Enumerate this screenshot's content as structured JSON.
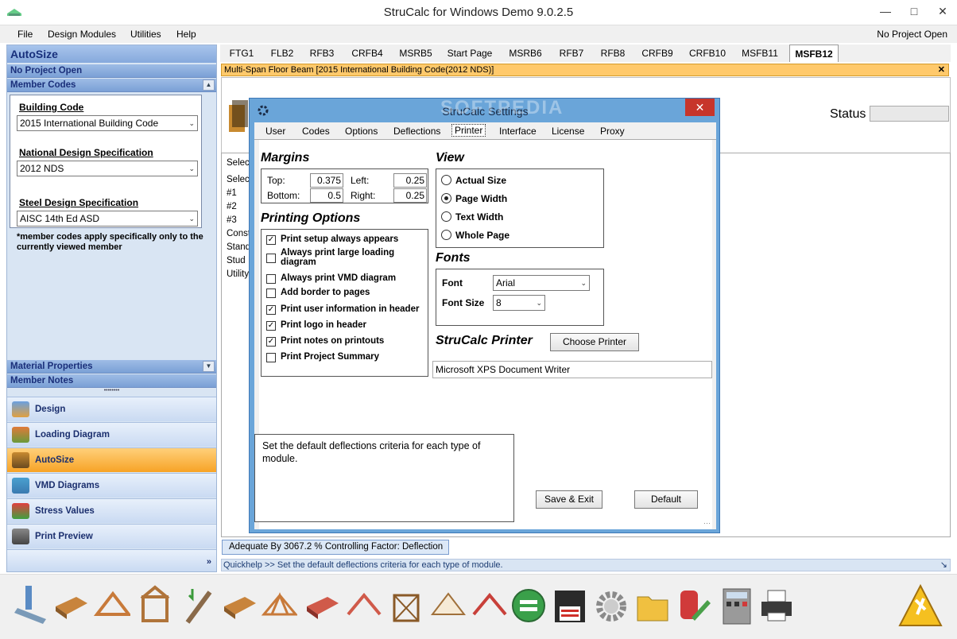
{
  "window": {
    "title": "StruCalc for Windows Demo 9.0.2.5"
  },
  "menu": {
    "items": [
      "File",
      "Design Modules",
      "Utilities",
      "Help"
    ],
    "project_status": "No Project Open"
  },
  "left_panel": {
    "title": "AutoSize",
    "project": "No Project Open",
    "member_codes_header": "Member Codes",
    "building_code_label": "Building Code",
    "building_code_value": "2015 International Building Code",
    "nds_label": "National Design Specification",
    "nds_value": "2012 NDS",
    "steel_label": "Steel Design Specification",
    "steel_value": "AISC 14th Ed ASD",
    "note": "*member codes apply specifically only to the currently viewed member",
    "material_properties": "Material Properties",
    "member_notes": "Member Notes",
    "nav": [
      {
        "label": "Design",
        "icon": "design-icon"
      },
      {
        "label": "Loading Diagram",
        "icon": "loading-diagram-icon"
      },
      {
        "label": "AutoSize",
        "icon": "autosize-icon"
      },
      {
        "label": "VMD Diagrams",
        "icon": "vmd-diagrams-icon"
      },
      {
        "label": "Stress Values",
        "icon": "stress-values-icon"
      },
      {
        "label": "Print Preview",
        "icon": "print-preview-icon"
      }
    ]
  },
  "tabs": [
    "FTG1",
    "FLB2",
    "RFB3",
    "CRFB4",
    "MSRB5",
    "Start Page",
    "MSRB6",
    "RFB7",
    "RFB8",
    "CRFB9",
    "CRFB10",
    "MSFB11",
    "MSFB12"
  ],
  "module_bar": {
    "text": "Multi-Span Floor Beam [2015 International Building Code(2012 NDS)]",
    "close": "✕"
  },
  "status": {
    "label": "Status"
  },
  "background_rows": [
    "Select",
    "Select",
    "#1",
    "#2",
    "#3",
    "Constr",
    "Stand",
    "Stud",
    "Utility"
  ],
  "adequate": {
    "text": "Adequate By  3067.2 %  Controlling Factor: Deflection"
  },
  "quickhelp": {
    "text": "Quickhelp >> Set the default deflections criteria for each type of module."
  },
  "dialog": {
    "title": "StruCalc Settings",
    "watermark": "SOFTPEDIA",
    "tabs": [
      "User",
      "Codes",
      "Options",
      "Deflections",
      "Printer",
      "Interface",
      "License",
      "Proxy"
    ],
    "selected_tab": "Printer",
    "margins": {
      "title": "Margins",
      "top_label": "Top:",
      "top": "0.375",
      "left_label": "Left:",
      "left": "0.25",
      "bottom_label": "Bottom:",
      "bottom": "0.5",
      "right_label": "Right:",
      "right": "0.25"
    },
    "printing_options": {
      "title": "Printing Options",
      "items": [
        {
          "label": "Print setup always appears",
          "checked": true
        },
        {
          "label": "Always print large loading diagram",
          "checked": false
        },
        {
          "label": "Always print VMD diagram",
          "checked": false
        },
        {
          "label": "Add border to pages",
          "checked": false
        },
        {
          "label": "Print user information in header",
          "checked": true
        },
        {
          "label": "Print logo in header",
          "checked": true
        },
        {
          "label": "Print notes on printouts",
          "checked": true
        },
        {
          "label": "Print Project Summary",
          "checked": false
        }
      ]
    },
    "view": {
      "title": "View",
      "options": [
        {
          "label": "Actual Size",
          "selected": false
        },
        {
          "label": "Page Width",
          "selected": true
        },
        {
          "label": "Text Width",
          "selected": false
        },
        {
          "label": "Whole Page",
          "selected": false
        }
      ]
    },
    "fonts": {
      "title": "Fonts",
      "font_label": "Font",
      "font_value": "Arial",
      "size_label": "Font Size",
      "size_value": "8"
    },
    "printer": {
      "title": "StruCalc Printer",
      "choose_button": "Choose Printer",
      "printer_name": "Microsoft XPS Document Writer"
    },
    "help_text": "Set the default deflections criteria for each type of module.",
    "save_button": "Save & Exit",
    "default_button": "Default"
  }
}
